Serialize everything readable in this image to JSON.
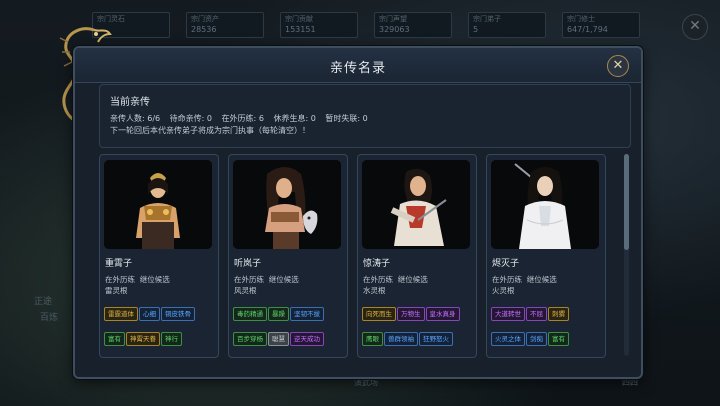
{
  "background": {
    "stats": [
      {
        "label": "宗门灵石",
        "value": ""
      },
      {
        "label": "宗门资产",
        "value": "28536"
      },
      {
        "label": "宗门贡献",
        "value": "153151"
      },
      {
        "label": "宗门声望",
        "value": "329063"
      },
      {
        "label": "宗门弟子",
        "value": "5"
      },
      {
        "label": "宗门修士",
        "value": "647/1,794"
      }
    ],
    "side_text_1": "正途",
    "side_text_2": "百炼",
    "bottom_left": "演武场",
    "bottom_right": "四四"
  },
  "modal": {
    "title": "亲传名录",
    "close_symbol": "✕",
    "section_title": "当前亲传",
    "stats": [
      {
        "label": "亲传人数:",
        "value": "6/6"
      },
      {
        "label": "待命亲传:",
        "value": "0"
      },
      {
        "label": "在外历练:",
        "value": "6"
      },
      {
        "label": "休养生息:",
        "value": "0"
      },
      {
        "label": "暂时失联:",
        "value": "0"
      }
    ],
    "note": "下一轮回后本代亲传弟子将成为宗门执事（每轮清空）！",
    "cards": [
      {
        "name": "重霄子",
        "status": "在外历练",
        "candidate": "继位候选",
        "root": "雷灵根",
        "tags": [
          {
            "text": "雷霆道体",
            "color": "gold"
          },
          {
            "text": "心细",
            "color": "blue"
          },
          {
            "text": "铜皮铁骨",
            "color": "blue"
          },
          {
            "text": "富有",
            "color": "green"
          },
          {
            "text": "神霄天眷",
            "color": "gold"
          },
          {
            "text": "神行",
            "color": "green"
          }
        ]
      },
      {
        "name": "听岚子",
        "status": "在外历练",
        "candidate": "继位候选",
        "root": "风灵根",
        "tags": [
          {
            "text": "毒药精通",
            "color": "green"
          },
          {
            "text": "暴躁",
            "color": "green"
          },
          {
            "text": "坚韧不拔",
            "color": "blue"
          },
          {
            "text": "百步穿杨",
            "color": "green"
          },
          {
            "text": "聪慧",
            "color": "gray"
          },
          {
            "text": "逆天成功",
            "color": "purple"
          }
        ]
      },
      {
        "name": "惊涛子",
        "status": "在外历练",
        "candidate": "继位候选",
        "root": "水灵根",
        "tags": [
          {
            "text": "向死而生",
            "color": "gold"
          },
          {
            "text": "万物生",
            "color": "purple"
          },
          {
            "text": "皇水真身",
            "color": "purple"
          },
          {
            "text": "鹰眼",
            "color": "green"
          },
          {
            "text": "兽群领袖",
            "color": "blue"
          },
          {
            "text": "狂野怒火",
            "color": "blue"
          }
        ]
      },
      {
        "name": "烬灭子",
        "status": "在外历练",
        "candidate": "继位候选",
        "root": "火灵根",
        "tags": [
          {
            "text": "大道转世",
            "color": "purple"
          },
          {
            "text": "不屈",
            "color": "purple"
          },
          {
            "text": "刺猬",
            "color": "gold"
          },
          {
            "text": "火灵之体",
            "color": "blue"
          },
          {
            "text": "剑痴",
            "color": "blue"
          },
          {
            "text": "富有",
            "color": "green"
          }
        ]
      }
    ]
  }
}
